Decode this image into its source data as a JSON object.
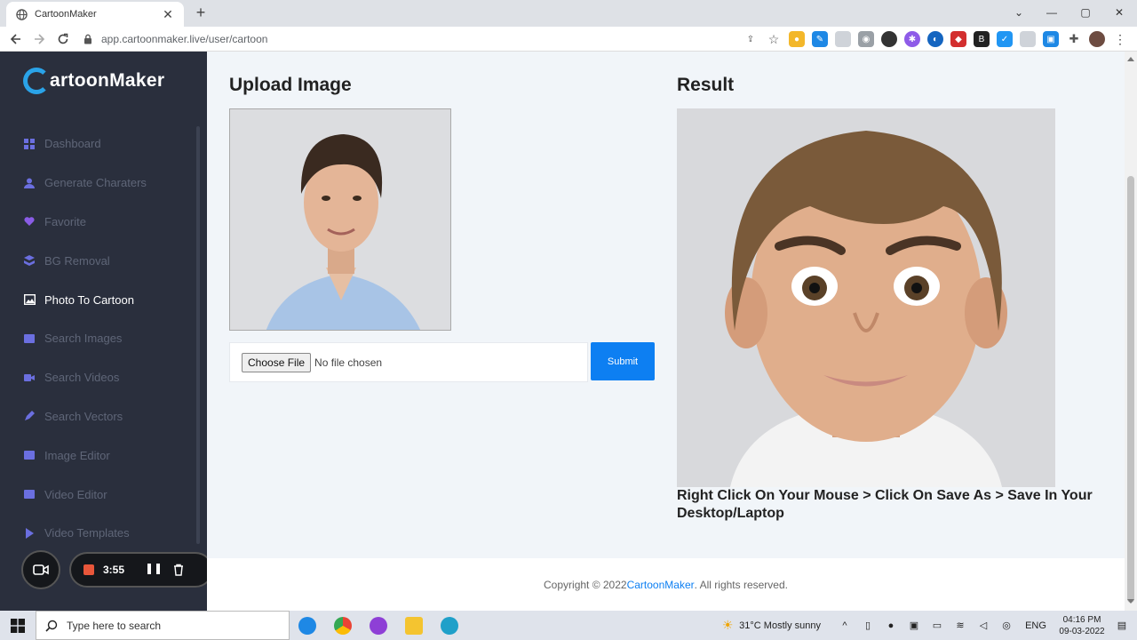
{
  "browser": {
    "tab_title": "CartoonMaker",
    "tab_close": "✕",
    "new_tab": "+",
    "url": "app.cartoonmaker.live/user/cartoon",
    "window_controls": {
      "minimize": "—",
      "maximize": "▢",
      "close": "✕",
      "chevron": "⌄"
    }
  },
  "sidebar": {
    "logo_prefix": "",
    "logo_text": "artoonMaker",
    "items": [
      {
        "label": "Dashboard",
        "icon": "grid-icon",
        "color": "#6b6fe0"
      },
      {
        "label": "Generate Charaters",
        "icon": "user-icon",
        "color": "#6b6fe0"
      },
      {
        "label": "Favorite",
        "icon": "heart-icon",
        "color": "#8a5ce6"
      },
      {
        "label": "BG Removal",
        "icon": "layers-icon",
        "color": "#6b6fe0"
      },
      {
        "label": "Photo To Cartoon",
        "icon": "image-icon",
        "color": "#ffffff",
        "active": true
      },
      {
        "label": "Search Images",
        "icon": "search-image-icon",
        "color": "#6b6fe0"
      },
      {
        "label": "Search Videos",
        "icon": "video-icon",
        "color": "#6b6fe0"
      },
      {
        "label": "Search Vectors",
        "icon": "pen-icon",
        "color": "#6b6fe0"
      },
      {
        "label": "Image Editor",
        "icon": "image-edit-icon",
        "color": "#6b6fe0"
      },
      {
        "label": "Video Editor",
        "icon": "video-edit-icon",
        "color": "#6b6fe0"
      },
      {
        "label": "Video Templates",
        "icon": "play-icon",
        "color": "#6b6fe0"
      }
    ]
  },
  "recorder": {
    "time": "3:55"
  },
  "main": {
    "upload_heading": "Upload Image",
    "result_heading": "Result",
    "choose_file_label": "Choose File",
    "no_file_text": "No file chosen",
    "submit_label": "Submit",
    "instructions": "Right Click On Your Mouse > Click On Save As > Save In Your Desktop/Laptop"
  },
  "footer": {
    "prefix": "Copyright © 2022 ",
    "brand": "CartoonMaker",
    "suffix": ". All rights reserved."
  },
  "taskbar": {
    "search_placeholder": "Type here to search",
    "weather": "31°C  Mostly sunny",
    "language": "ENG",
    "time": "04:16 PM",
    "date": "09-03-2022"
  },
  "colors": {
    "accent": "#0d7ff2",
    "sidebar_bg": "#2a2f3d",
    "logo_accent": "#2aa3e8"
  }
}
